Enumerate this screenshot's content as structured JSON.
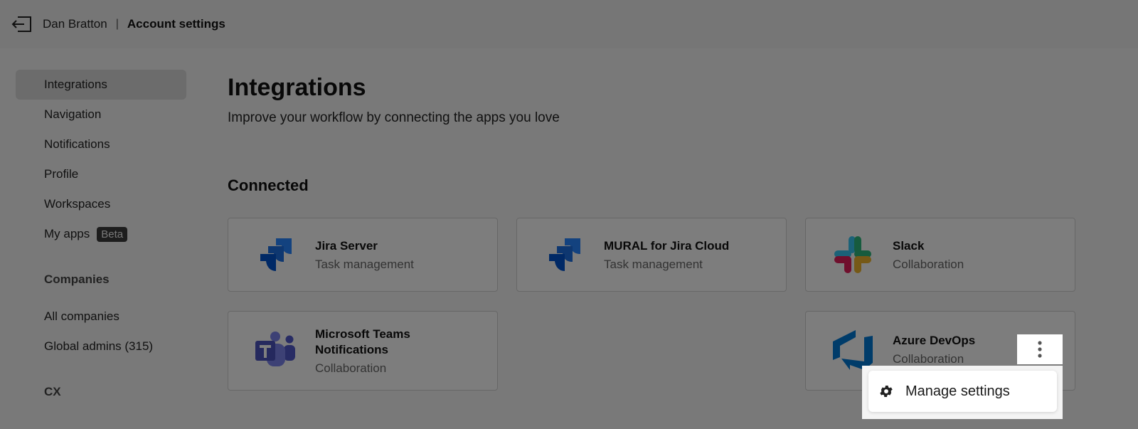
{
  "header": {
    "user_name": "Dan Bratton",
    "separator": "|",
    "page_title": "Account settings",
    "back_icon": "exit-icon"
  },
  "sidebar": {
    "items": [
      {
        "label": "Integrations",
        "active": true
      },
      {
        "label": "Navigation"
      },
      {
        "label": "Notifications"
      },
      {
        "label": "Profile"
      },
      {
        "label": "Workspaces"
      },
      {
        "label": "My apps",
        "badge": "Beta"
      }
    ],
    "companies_heading": "Companies",
    "company_items": [
      {
        "label": "All companies"
      },
      {
        "label": "Global admins (315)"
      }
    ],
    "cx_heading": "CX"
  },
  "main": {
    "title": "Integrations",
    "subtitle": "Improve your workflow by connecting the apps you love",
    "connected_heading": "Connected",
    "cards": [
      {
        "name": "Jira Server",
        "category": "Task management",
        "icon": "jira-icon"
      },
      {
        "name": "MURAL for Jira Cloud",
        "category": "Task management",
        "icon": "jira-icon"
      },
      {
        "name": "Slack",
        "category": "Collaboration",
        "icon": "slack-icon"
      },
      {
        "name": "Microsoft Teams Notifications",
        "category": "Collaboration",
        "icon": "teams-icon"
      },
      {
        "name": "Azure DevOps",
        "category": "Collaboration",
        "icon": "azure-devops-icon"
      }
    ]
  },
  "context_menu": {
    "items": [
      {
        "label": "Manage settings",
        "icon": "gear-icon"
      }
    ]
  },
  "colors": {
    "jira_blue": "#2684ff",
    "teams_purple": "#5059c9",
    "azure_blue": "#0078d4",
    "overlay": "#000000"
  }
}
